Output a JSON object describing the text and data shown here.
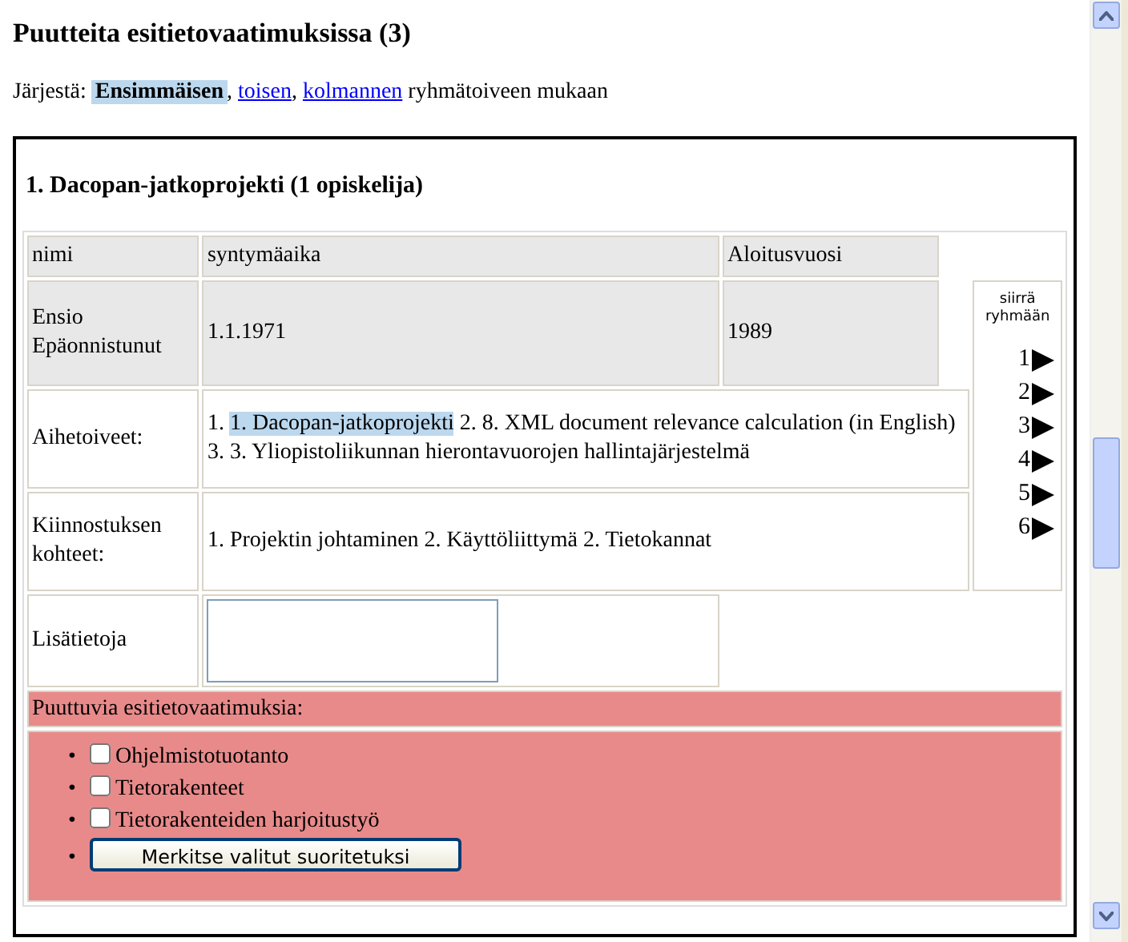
{
  "heading": "Puutteita esitietovaatimuksissa (3)",
  "sort": {
    "label": "Järjestä:",
    "separator": ",",
    "suffix": "ryhmätoiveen mukaan",
    "options": [
      {
        "text": "Ensimmäisen",
        "selected": true
      },
      {
        "text": "toisen",
        "selected": false
      },
      {
        "text": "kolmannen",
        "selected": false
      }
    ]
  },
  "group": {
    "title": "1. Dacopan-jatkoprojekti (1 opiskelija)",
    "columns": [
      "nimi",
      "syntymäaika",
      "Aloitusvuosi"
    ],
    "student": {
      "name": "Ensio Epäonnistunut",
      "birth": "1.1.1971",
      "start": "1989"
    },
    "move": {
      "label": "siirrä ryhmään",
      "targets": [
        "1",
        "2",
        "3",
        "4",
        "5",
        "6"
      ]
    },
    "wishes": {
      "label": "Aihetoiveet:",
      "parts": [
        {
          "text": "1.",
          "selected": false
        },
        {
          "text": "1. Dacopan-jatkoprojekti",
          "selected": true
        },
        {
          "text": "2. 8. XML document relevance calculation (in English) 3. 3. Yliopistoliikunnan hierontavuorojen hallintajärjestelmä",
          "selected": false
        }
      ]
    },
    "interests": {
      "label": "Kiinnostuksen kohteet:",
      "text": "1. Projektin johtaminen 2. Käyttöliittymä 2. Tietokannat"
    },
    "extra": {
      "label": "Lisätietoja"
    },
    "missing": {
      "label": "Puuttuvia esitietovaatimuksia:",
      "bullet": "•",
      "items": [
        {
          "label": "Ohjelmistotuotanto",
          "checked": false
        },
        {
          "label": "Tietorakenteet",
          "checked": false
        },
        {
          "label": "Tietorakenteiden harjoitustyö",
          "checked": false
        }
      ],
      "button": "Merkitse valitut suoritetuksi"
    }
  }
}
